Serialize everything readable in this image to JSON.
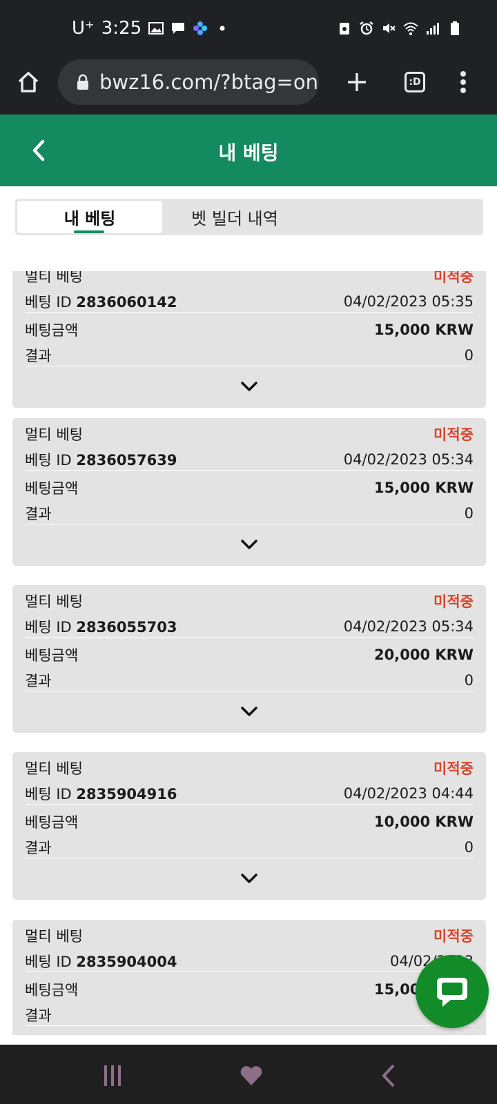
{
  "status_bar": {
    "carrier": "U⁺",
    "time": "3:25"
  },
  "browser": {
    "url": "bwz16.com/?btag=on",
    "tab_count": ":D"
  },
  "header": {
    "title": "내 베팅"
  },
  "tabs": [
    {
      "label": "내 베팅",
      "active": true
    },
    {
      "label": "벳 빌더 내역",
      "active": false
    }
  ],
  "labels": {
    "bet_id_prefix": "베팅 ID",
    "amount_label": "베팅금액",
    "result_label": "결과"
  },
  "bets": [
    {
      "type": "멀티 베팅",
      "status": "미적중",
      "bet_id": "2836060142",
      "datetime": "04/02/2023 05:35",
      "amount": "15,000 KRW",
      "result": "0"
    },
    {
      "type": "멀티 베팅",
      "status": "미적중",
      "bet_id": "2836057639",
      "datetime": "04/02/2023 05:34",
      "amount": "15,000 KRW",
      "result": "0"
    },
    {
      "type": "멀티 베팅",
      "status": "미적중",
      "bet_id": "2836055703",
      "datetime": "04/02/2023 05:34",
      "amount": "20,000 KRW",
      "result": "0"
    },
    {
      "type": "멀티 베팅",
      "status": "미적중",
      "bet_id": "2835904916",
      "datetime": "04/02/2023 04:44",
      "amount": "10,000 KRW",
      "result": "0"
    },
    {
      "type": "멀티 베팅",
      "status": "미적중",
      "bet_id": "2835904004",
      "datetime": "04/02/2023",
      "amount": "15,000 KRW",
      "result": "0"
    }
  ],
  "colors": {
    "header_green": "#138a5f",
    "status_red": "#d6452e",
    "chat_green": "#128b29"
  },
  "icons": [
    "home-icon",
    "lock-icon",
    "plus-icon",
    "tab-switcher-icon",
    "more-vert-icon",
    "back-arrow-icon",
    "chevron-down-icon",
    "chat-icon",
    "recent-apps-icon",
    "home-heart-icon",
    "nav-back-icon"
  ]
}
